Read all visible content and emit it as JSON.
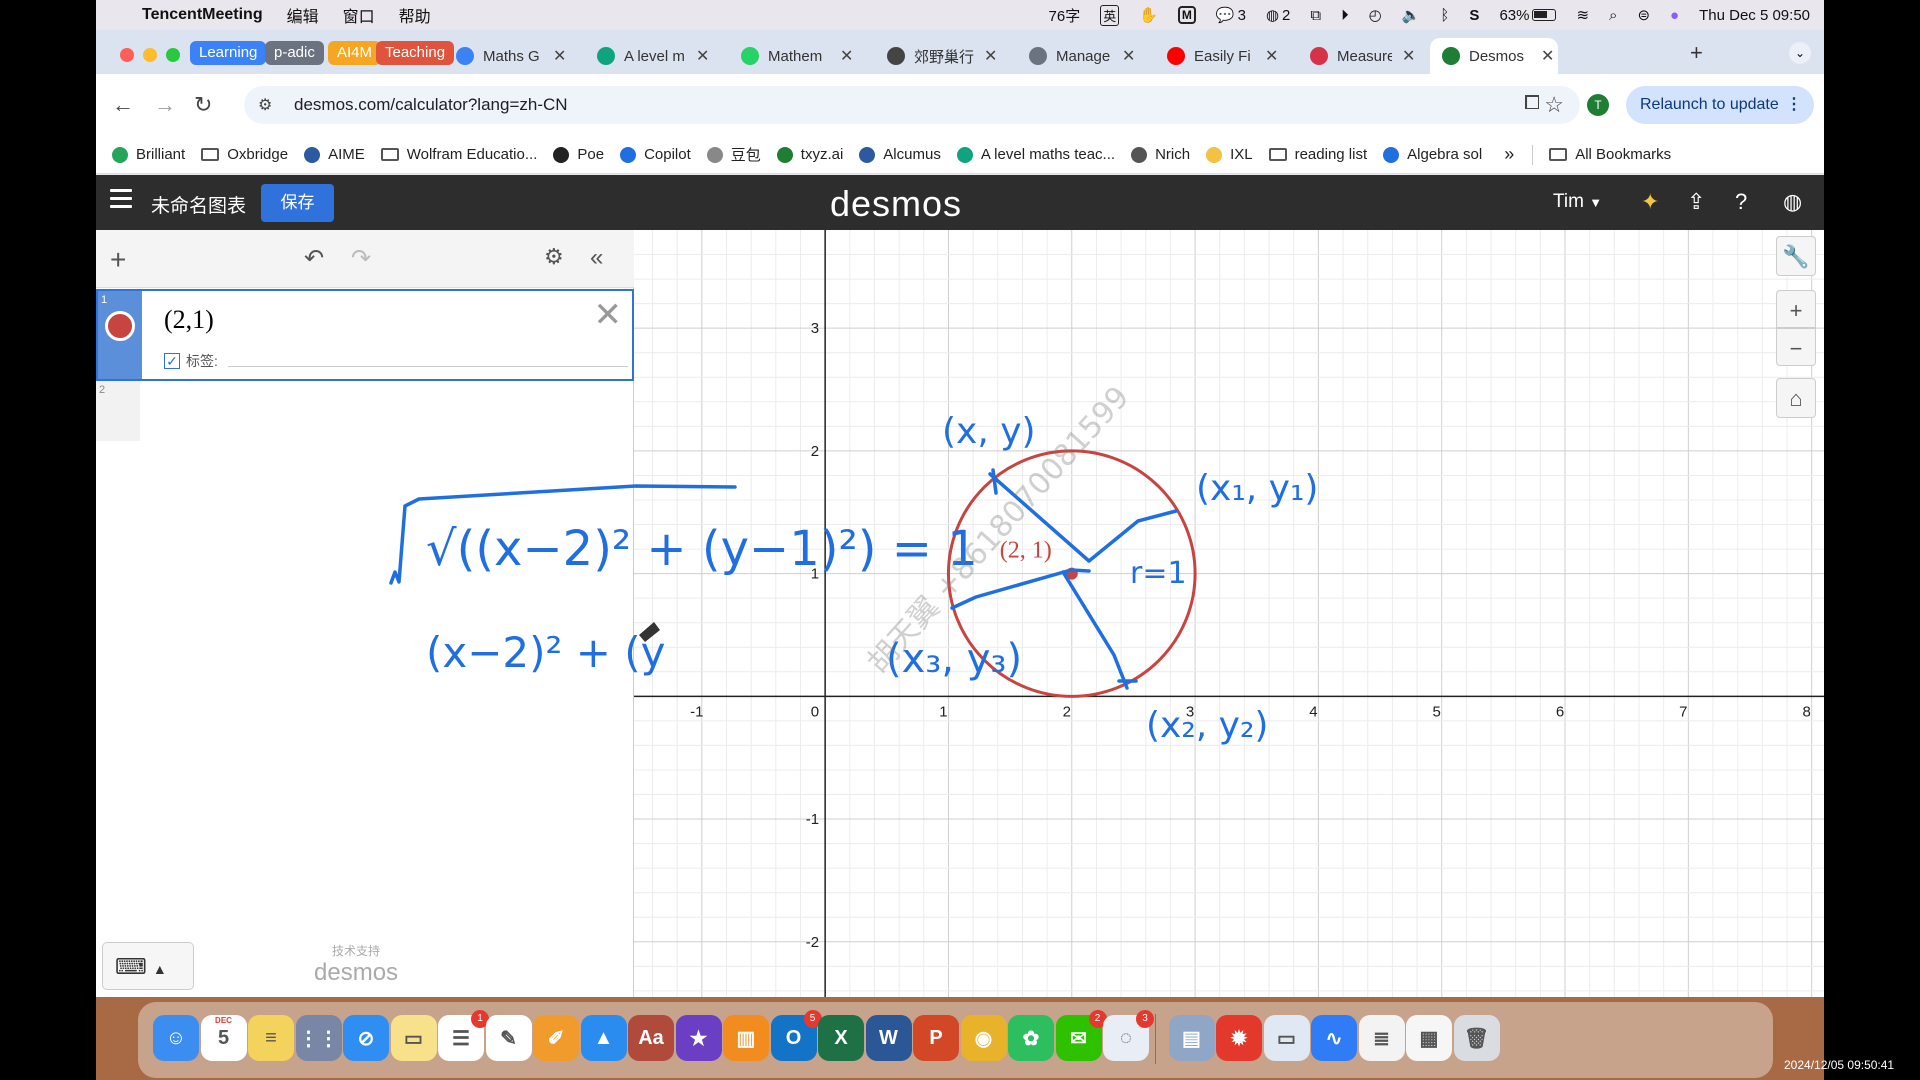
{
  "menubar": {
    "app": "TencentMeeting",
    "items": [
      "编辑",
      "窗口",
      "帮助"
    ],
    "status": {
      "word_count": "76字",
      "input_method": "英",
      "notifications": "3",
      "wechat_count": "2",
      "battery": "63%",
      "datetime": "Thu Dec 5  09:50"
    }
  },
  "tabs": {
    "groups": [
      {
        "label": "Learning",
        "color": "#3b82f6"
      },
      {
        "label": "p-adic",
        "color": "#6b7280"
      },
      {
        "label": "AI4M",
        "color": "#f5a623"
      },
      {
        "label": "Teaching",
        "color": "#e0533d"
      }
    ],
    "items": [
      {
        "title": "Maths G",
        "icon": "p-icon",
        "color": "#3b82f6"
      },
      {
        "title": "A level m",
        "icon": "chatgpt-icon",
        "color": "#10a37f"
      },
      {
        "title": "Mathem",
        "icon": "whatsapp-icon",
        "color": "#25d366"
      },
      {
        "title": "郊野巢行",
        "icon": "globe-icon",
        "color": "#444444"
      },
      {
        "title": "Manage",
        "icon": "mi-icon",
        "color": "#6b7280"
      },
      {
        "title": "Easily Fi",
        "icon": "youtube-icon",
        "color": "#ff0000"
      },
      {
        "title": "Measure",
        "icon": "measure-icon",
        "color": "#d6334a"
      },
      {
        "title": "Desmos",
        "icon": "desmos-icon",
        "color": "#1e7e34"
      }
    ]
  },
  "toolbar": {
    "url": "desmos.com/calculator?lang=zh-CN",
    "avatar_letter": "T",
    "relaunch_label": "Relaunch to update"
  },
  "bookmarks": [
    {
      "label": "Brilliant",
      "icon": "brilliant-icon"
    },
    {
      "label": "Oxbridge",
      "icon": "folder-icon"
    },
    {
      "label": "AIME",
      "icon": "cube-icon"
    },
    {
      "label": "Wolfram Educatio...",
      "icon": "folder-icon"
    },
    {
      "label": "Poe",
      "icon": "poe-icon"
    },
    {
      "label": "Copilot",
      "icon": "bing-icon"
    },
    {
      "label": "豆包",
      "icon": "doubao-icon"
    },
    {
      "label": "txyz.ai",
      "icon": "txyz-icon"
    },
    {
      "label": "Alcumus",
      "icon": "cube-icon"
    },
    {
      "label": "A level maths teac...",
      "icon": "chatgpt-icon"
    },
    {
      "label": "Nrich",
      "icon": "globe-icon"
    },
    {
      "label": "IXL",
      "icon": "ixl-icon"
    },
    {
      "label": "reading list",
      "icon": "folder-icon"
    },
    {
      "label": "Algebra sol",
      "icon": "search-icon"
    }
  ],
  "bookmarks_more": "»",
  "all_bookmarks": "All Bookmarks",
  "desmos": {
    "graph_title": "未命名图表",
    "save_label": "保存",
    "logo": "desmos",
    "user": "Tim",
    "expressions": [
      {
        "index": "1",
        "latex": "(2,1)",
        "label_text": "标签:",
        "color": "#c74440"
      },
      {
        "index": "2"
      }
    ],
    "powered_by": "技术支持",
    "powered_logo": "desmos",
    "point_label": "(2, 1)"
  },
  "chart_data": {
    "type": "scatter",
    "x_ticks": [
      "-1",
      "0",
      "1",
      "2",
      "3",
      "4",
      "5",
      "6",
      "7",
      "8"
    ],
    "y_ticks": [
      "-2",
      "-1",
      "1",
      "2",
      "3"
    ],
    "xlim": [
      -1.55,
      8.1
    ],
    "ylim": [
      -2.45,
      3.8
    ],
    "grid": true,
    "points": [
      {
        "x": 2,
        "y": 1,
        "label": "(2, 1)",
        "color": "#c74440"
      }
    ],
    "circle": {
      "cx": 2,
      "cy": 1,
      "r": 1,
      "color": "#c74440"
    }
  },
  "annotations": {
    "formula1": "√((x−2)² + (y−1)²) = 1",
    "formula2": "(x−2)² + (y",
    "point_xy": "(x, y)",
    "point_1": "(x₁, y₁)",
    "point_2": "(x₂, y₂)",
    "point_3": "(x₃, y₃)",
    "radius": "r=1",
    "watermark": "胡天翼 +8618070081599"
  },
  "dock": [
    {
      "name": "finder-icon",
      "color": "#3b8ef0",
      "glyph": "☺"
    },
    {
      "name": "calendar-icon",
      "color": "#ffffff",
      "glyph": "5",
      "extra": "DEC"
    },
    {
      "name": "notes-icon",
      "color": "#f3d35b",
      "glyph": "≡"
    },
    {
      "name": "launchpad-icon",
      "color": "#7a86a6",
      "glyph": "⋮⋮"
    },
    {
      "name": "safari-icon",
      "color": "#2e8ef2",
      "glyph": "⊘"
    },
    {
      "name": "stickies-icon",
      "color": "#f7e28b",
      "glyph": "▭"
    },
    {
      "name": "reminders-icon",
      "color": "#ffffff",
      "glyph": "☰",
      "badge": "1"
    },
    {
      "name": "freeform-icon",
      "color": "#ffffff",
      "glyph": "✎"
    },
    {
      "name": "pages-icon",
      "color": "#f19b2c",
      "glyph": "✐"
    },
    {
      "name": "keynote-icon",
      "color": "#2b8cf0",
      "glyph": "▲"
    },
    {
      "name": "dictionary-icon",
      "color": "#b04a3a",
      "glyph": "Aa"
    },
    {
      "name": "imovie-icon",
      "color": "#6a3fc4",
      "glyph": "★"
    },
    {
      "name": "books-icon",
      "color": "#f28c1e",
      "glyph": "▥"
    },
    {
      "name": "outlook-icon",
      "color": "#1273c7",
      "glyph": "O",
      "badge": "5"
    },
    {
      "name": "excel-icon",
      "color": "#1e7145",
      "glyph": "X"
    },
    {
      "name": "word-icon",
      "color": "#2b5797",
      "glyph": "W"
    },
    {
      "name": "powerpoint-icon",
      "color": "#d24726",
      "glyph": "P"
    },
    {
      "name": "chrome-icon",
      "color": "#e9b22b",
      "glyph": "◉"
    },
    {
      "name": "evernote-icon",
      "color": "#2dbe60",
      "glyph": "✿"
    },
    {
      "name": "wechat-icon",
      "color": "#2dc100",
      "glyph": "✉",
      "badge": "2"
    },
    {
      "name": "messages-icon",
      "color": "#e9eef6",
      "glyph": "◌",
      "badge": "3"
    },
    {
      "name": "preview-icon",
      "color": "#8fa6c6",
      "glyph": "▤"
    },
    {
      "name": "app-icon",
      "color": "#e3392d",
      "glyph": "✹"
    },
    {
      "name": "screen-share-icon",
      "color": "#dfe8f3",
      "glyph": "▭"
    },
    {
      "name": "tencent-meeting-icon",
      "color": "#2f7cf6",
      "glyph": "∿"
    },
    {
      "name": "documents-icon",
      "color": "#f3f3f3",
      "glyph": "≣"
    },
    {
      "name": "screenshot-icon",
      "color": "#f6f6f6",
      "glyph": "▦"
    },
    {
      "name": "trash-icon",
      "color": "#d9dde2",
      "glyph": "🗑"
    }
  ],
  "timestamp": "2024/12/05 09:50:41"
}
